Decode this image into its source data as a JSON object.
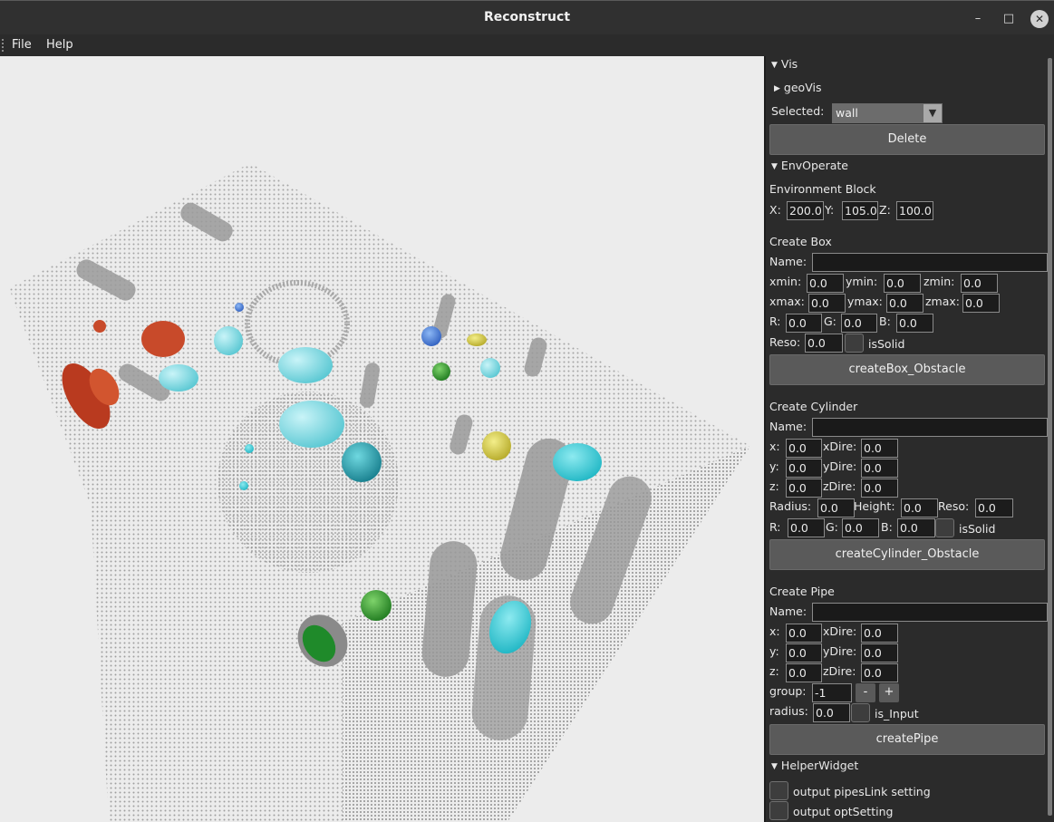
{
  "window": {
    "title": "Reconstruct"
  },
  "menu": {
    "file": "File",
    "help": "Help"
  },
  "vis": {
    "header": "Vis",
    "geoVis": "geoVis",
    "selected_label": "Selected:",
    "selected_value": "wall",
    "delete_label": "Delete"
  },
  "env": {
    "header": "EnvOperate",
    "block_title": "Environment Block",
    "x_label": "X:",
    "x_value": "200.0",
    "y_label": "Y:",
    "y_value": "105.0",
    "z_label": "Z:",
    "z_value": "100.0"
  },
  "box": {
    "title": "Create Box",
    "name_label": "Name:",
    "xmin_label": "xmin:",
    "xmin": "0.0",
    "ymin_label": "ymin:",
    "ymin": "0.0",
    "zmin_label": "zmin:",
    "zmin": "0.0",
    "xmax_label": "xmax:",
    "xmax": "0.0",
    "ymax_label": "ymax:",
    "ymax": "0.0",
    "zmax_label": "zmax:",
    "zmax": "0.0",
    "r_label": "R:",
    "r": "0.0",
    "g_label": "G:",
    "g": "0.0",
    "b_label": "B:",
    "b": "0.0",
    "reso_label": "Reso:",
    "reso": "0.0",
    "solid_label": "isSolid",
    "button": "createBox_Obstacle"
  },
  "cylinder": {
    "title": "Create Cylinder",
    "name_label": "Name:",
    "x_label": "x:",
    "x": "0.0",
    "y_label": "y:",
    "y": "0.0",
    "z_label": "z:",
    "z": "0.0",
    "xdire_label": "xDire:",
    "xdire": "0.0",
    "ydire_label": "yDire:",
    "ydire": "0.0",
    "zdire_label": "zDire:",
    "zdire": "0.0",
    "radius_label": "Radius:",
    "radius": "0.0",
    "height_label": "Height:",
    "height": "0.0",
    "reso_label": "Reso:",
    "reso": "0.0",
    "r_label": "R:",
    "r": "0.0",
    "g_label": "G:",
    "g": "0.0",
    "b_label": "B:",
    "b": "0.0",
    "solid_label": "isSolid",
    "button": "createCylinder_Obstacle"
  },
  "pipe": {
    "title": "Create Pipe",
    "name_label": "Name:",
    "x_label": "x:",
    "x": "0.0",
    "y_label": "y:",
    "y": "0.0",
    "z_label": "z:",
    "z": "0.0",
    "xdire_label": "xDire:",
    "xdire": "0.0",
    "ydire_label": "yDire:",
    "ydire": "0.0",
    "zdire_label": "zDire:",
    "zdire": "0.0",
    "group_label": "group:",
    "group": "-1",
    "minus": "-",
    "plus": "+",
    "radius_label": "radius:",
    "radius": "0.0",
    "input_label": "is_Input",
    "button": "createPipe"
  },
  "helper": {
    "header": "HelperWidget",
    "opt1": "output pipesLink setting",
    "opt2": "output optSetting"
  },
  "icons": {
    "minimize": "minimize-icon",
    "maximize": "maximize-icon",
    "close": "close-icon",
    "expanded": "triangle-down-icon",
    "collapsed": "triangle-right-icon",
    "dropdown": "triangle-down-icon"
  },
  "colors": {
    "viewport_bg": "#ececec",
    "panel_bg": "#2b2b2b",
    "button_bg": "#5a5a5a",
    "point_cloud": "#8c8c8c"
  }
}
